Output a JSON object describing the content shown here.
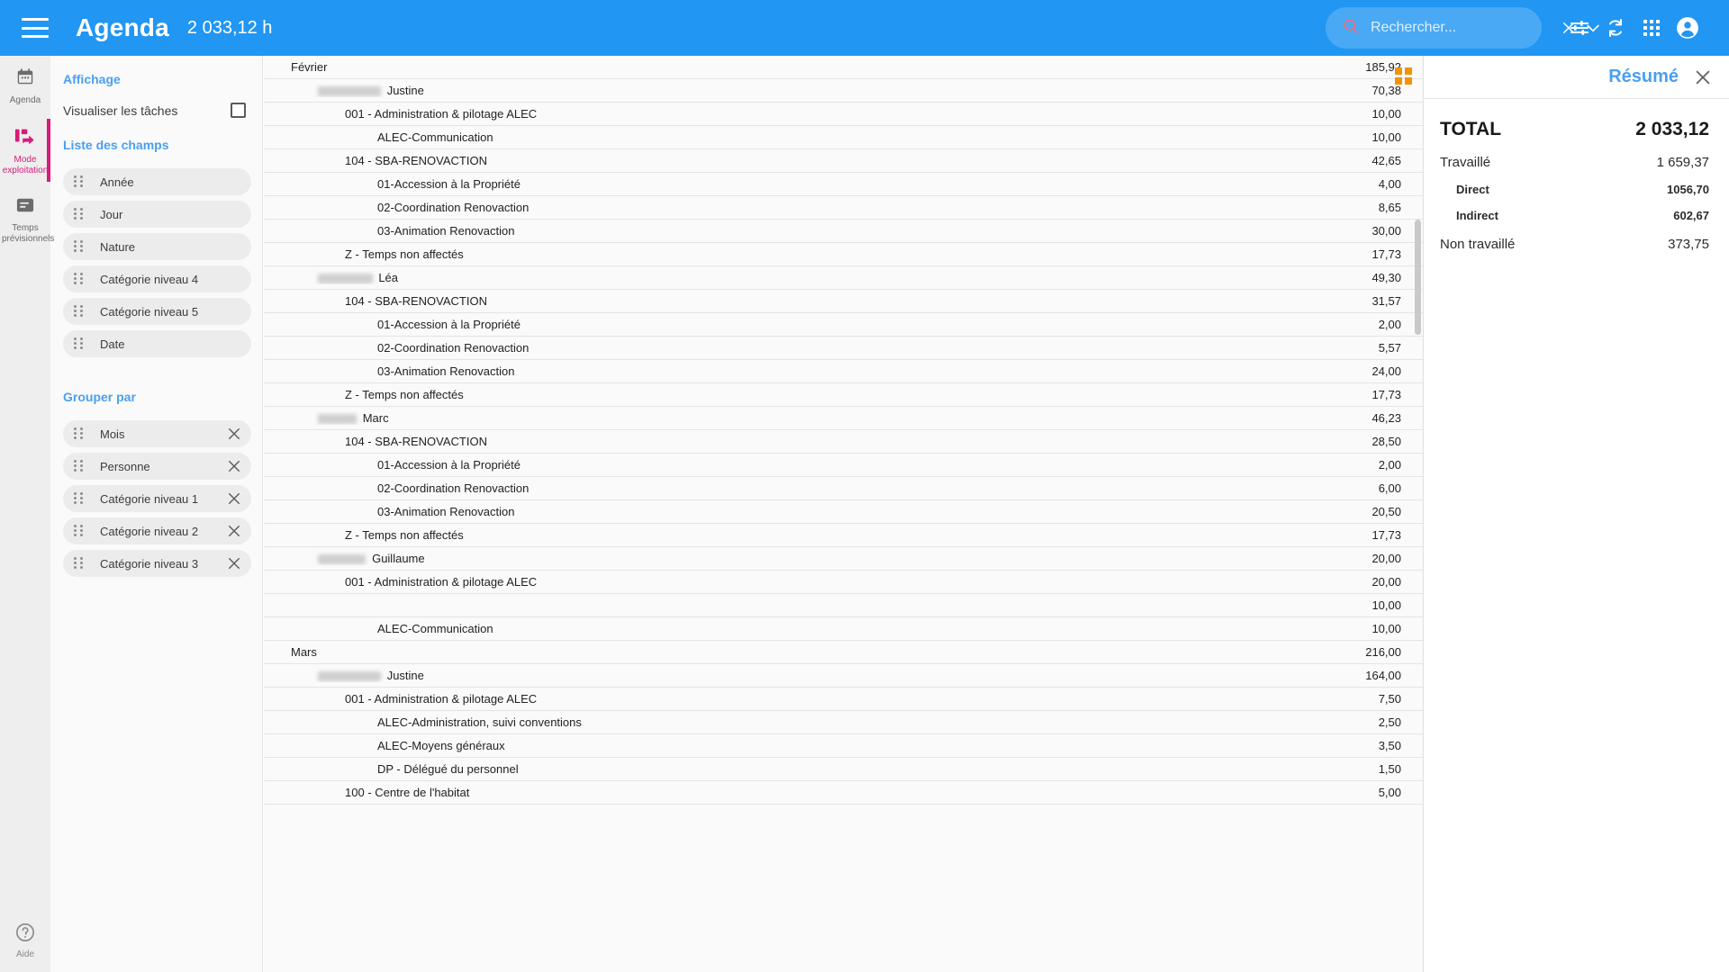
{
  "appbar": {
    "menu_icon": "hamburger-icon",
    "title": "Agenda",
    "total_hours": "2 033,12 h",
    "search_placeholder": "Rechercher...",
    "search_value": "",
    "icons": {
      "search": "search-icon",
      "clear": "close-icon",
      "expand": "chevron-down-icon",
      "filters": "tune-icon",
      "refresh": "sync-icon",
      "apps": "apps-grid-icon",
      "account": "account-circle-icon"
    }
  },
  "rail": {
    "items": [
      {
        "label": "Agenda",
        "icon": "calendar-icon",
        "active": false
      },
      {
        "label": "Mode exploitation",
        "icon": "exploitation-icon",
        "active": true
      },
      {
        "label": "Temps prévisionnels",
        "icon": "forecast-icon",
        "active": false
      }
    ],
    "help": {
      "label": "Aide",
      "icon": "help-icon"
    }
  },
  "config": {
    "display_title": "Affichage",
    "visualize_tasks_label": "Visualiser les tâches",
    "visualize_tasks_checked": false,
    "fields_title": "Liste des champs",
    "fields": [
      {
        "label": "Année"
      },
      {
        "label": "Jour"
      },
      {
        "label": "Nature"
      },
      {
        "label": "Catégorie niveau 4"
      },
      {
        "label": "Catégorie niveau 5"
      },
      {
        "label": "Date"
      }
    ],
    "group_title": "Grouper par",
    "groups": [
      {
        "label": "Mois"
      },
      {
        "label": "Personne"
      },
      {
        "label": "Catégorie niveau 1"
      },
      {
        "label": "Catégorie niveau 2"
      },
      {
        "label": "Catégorie niveau 3"
      }
    ]
  },
  "main": {
    "grid_icon": "layout-grid-icon",
    "rows": [
      {
        "level": 0,
        "label": "Février",
        "value": "185,92",
        "redacted": ""
      },
      {
        "level": 1,
        "label": "Justine",
        "value": "70,38",
        "redacted": "ALLEMAND"
      },
      {
        "level": 2,
        "label": "001 - Administration & pilotage ALEC",
        "value": "10,00",
        "redacted": ""
      },
      {
        "level": 3,
        "label": "ALEC-Communication",
        "value": "10,00",
        "redacted": ""
      },
      {
        "level": 2,
        "label": "104 - SBA-RENOVACTION",
        "value": "42,65",
        "redacted": ""
      },
      {
        "level": 3,
        "label": "01-Accession à la Propriété",
        "value": "4,00",
        "redacted": ""
      },
      {
        "level": 3,
        "label": "02-Coordination Renovaction",
        "value": "8,65",
        "redacted": ""
      },
      {
        "level": 3,
        "label": "03-Animation Renovaction",
        "value": "30,00",
        "redacted": ""
      },
      {
        "level": 2,
        "label": "Z - Temps non affectés",
        "value": "17,73",
        "redacted": ""
      },
      {
        "level": 1,
        "label": "Léa",
        "value": "49,30",
        "redacted": "GALLAND"
      },
      {
        "level": 2,
        "label": "104 - SBA-RENOVACTION",
        "value": "31,57",
        "redacted": ""
      },
      {
        "level": 3,
        "label": "01-Accession à la Propriété",
        "value": "2,00",
        "redacted": ""
      },
      {
        "level": 3,
        "label": "02-Coordination Renovaction",
        "value": "5,57",
        "redacted": ""
      },
      {
        "level": 3,
        "label": "03-Animation Renovaction",
        "value": "24,00",
        "redacted": ""
      },
      {
        "level": 2,
        "label": "Z - Temps non affectés",
        "value": "17,73",
        "redacted": ""
      },
      {
        "level": 1,
        "label": "Marc",
        "value": "46,23",
        "redacted": "BARTE"
      },
      {
        "level": 2,
        "label": "104 - SBA-RENOVACTION",
        "value": "28,50",
        "redacted": ""
      },
      {
        "level": 3,
        "label": "01-Accession à la Propriété",
        "value": "2,00",
        "redacted": ""
      },
      {
        "level": 3,
        "label": "02-Coordination Renovaction",
        "value": "6,00",
        "redacted": ""
      },
      {
        "level": 3,
        "label": "03-Animation Renovaction",
        "value": "20,50",
        "redacted": ""
      },
      {
        "level": 2,
        "label": "Z - Temps non affectés",
        "value": "17,73",
        "redacted": ""
      },
      {
        "level": 1,
        "label": "Guillaume",
        "value": "20,00",
        "redacted": "DELMAS"
      },
      {
        "level": 2,
        "label": "001 - Administration & pilotage ALEC",
        "value": "20,00",
        "redacted": ""
      },
      {
        "level": 2,
        "label": "",
        "value": "10,00",
        "redacted": ""
      },
      {
        "level": 3,
        "label": "ALEC-Communication",
        "value": "10,00",
        "redacted": ""
      },
      {
        "level": 0,
        "label": "Mars",
        "value": "216,00",
        "redacted": ""
      },
      {
        "level": 1,
        "label": "Justine",
        "value": "164,00",
        "redacted": "ALLEMAND"
      },
      {
        "level": 2,
        "label": "001 - Administration & pilotage ALEC",
        "value": "7,50",
        "redacted": ""
      },
      {
        "level": 3,
        "label": "ALEC-Administration, suivi conventions",
        "value": "2,50",
        "redacted": ""
      },
      {
        "level": 3,
        "label": "ALEC-Moyens généraux",
        "value": "3,50",
        "redacted": ""
      },
      {
        "level": 3,
        "label": "DP - Délégué du personnel",
        "value": "1,50",
        "redacted": ""
      },
      {
        "level": 2,
        "label": "100 - Centre de l'habitat",
        "value": "5,00",
        "redacted": ""
      }
    ]
  },
  "summary": {
    "title": "Résumé",
    "close_icon": "close-icon",
    "total_label": "TOTAL",
    "total_value": "2 033,12",
    "rows": [
      {
        "label": "Travaillé",
        "value": "1 659,37",
        "level": 1
      },
      {
        "label": "Direct",
        "value": "1056,70",
        "level": 2
      },
      {
        "label": "Indirect",
        "value": "602,67",
        "level": 2
      },
      {
        "label": "Non travaillé",
        "value": "373,75",
        "level": 1
      }
    ]
  },
  "colors": {
    "brand_blue": "#2196f3",
    "accent_pink": "#d81b7a",
    "link_blue": "#4a9ff0",
    "orange": "#f59200"
  }
}
